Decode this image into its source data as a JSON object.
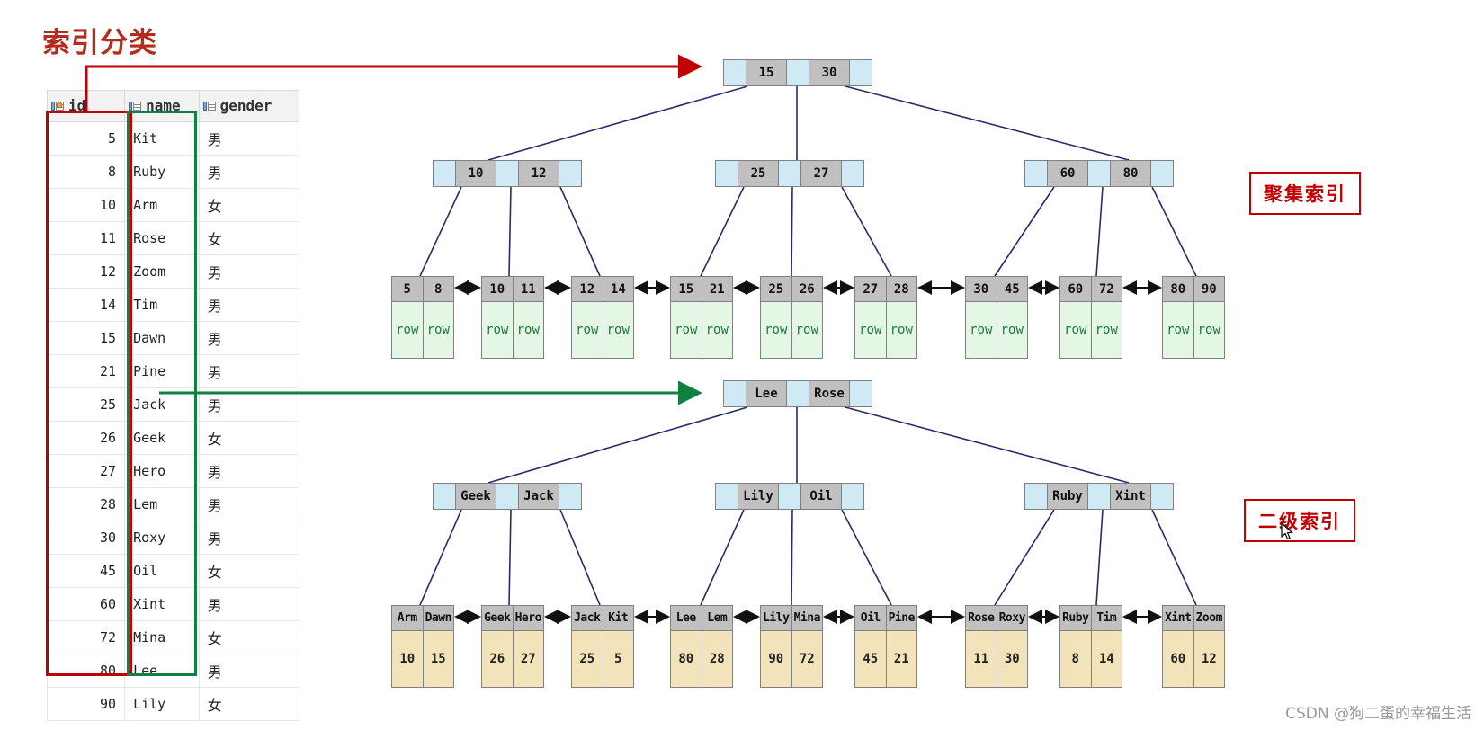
{
  "page": {
    "title": "索引分类",
    "watermark": "CSDN @狗二蛋的幸福生活"
  },
  "table": {
    "columns": [
      {
        "key": "id",
        "label": "id",
        "icon": "primary-key-icon"
      },
      {
        "key": "name",
        "label": "name",
        "icon": "column-icon"
      },
      {
        "key": "gender",
        "label": "gender",
        "icon": "column-icon"
      }
    ],
    "rows": [
      {
        "id": "5",
        "name": "Kit",
        "gender": "男"
      },
      {
        "id": "8",
        "name": "Ruby",
        "gender": "男"
      },
      {
        "id": "10",
        "name": "Arm",
        "gender": "女"
      },
      {
        "id": "11",
        "name": "Rose",
        "gender": "女"
      },
      {
        "id": "12",
        "name": "Zoom",
        "gender": "男"
      },
      {
        "id": "14",
        "name": "Tim",
        "gender": "男"
      },
      {
        "id": "15",
        "name": "Dawn",
        "gender": "男"
      },
      {
        "id": "21",
        "name": "Pine",
        "gender": "男"
      },
      {
        "id": "25",
        "name": "Jack",
        "gender": "男"
      },
      {
        "id": "26",
        "name": "Geek",
        "gender": "女"
      },
      {
        "id": "27",
        "name": "Hero",
        "gender": "男"
      },
      {
        "id": "28",
        "name": "Lem",
        "gender": "男"
      },
      {
        "id": "30",
        "name": "Roxy",
        "gender": "男"
      },
      {
        "id": "45",
        "name": "Oil",
        "gender": "女"
      },
      {
        "id": "60",
        "name": "Xint",
        "gender": "男"
      },
      {
        "id": "72",
        "name": "Mina",
        "gender": "女"
      },
      {
        "id": "80",
        "name": "Lee",
        "gender": "男"
      },
      {
        "id": "90",
        "name": "Lily",
        "gender": "女"
      }
    ],
    "highlight": {
      "id_column_color": "#c00000",
      "name_column_color": "#0f8040"
    }
  },
  "labels": {
    "clustered": "聚集索引",
    "secondary": "二级索引",
    "clustered_color": "#c00000",
    "secondary_color": "#c00000"
  },
  "clustered_index": {
    "root": {
      "keys": [
        "15",
        "30"
      ]
    },
    "internal": [
      {
        "keys": [
          "10",
          "12"
        ]
      },
      {
        "keys": [
          "25",
          "27"
        ]
      },
      {
        "keys": [
          "60",
          "80"
        ]
      }
    ],
    "leaves": [
      {
        "keys": [
          "5",
          "8"
        ],
        "values": [
          "row",
          "row"
        ]
      },
      {
        "keys": [
          "10",
          "11"
        ],
        "values": [
          "row",
          "row"
        ]
      },
      {
        "keys": [
          "12",
          "14"
        ],
        "values": [
          "row",
          "row"
        ]
      },
      {
        "keys": [
          "15",
          "21"
        ],
        "values": [
          "row",
          "row"
        ]
      },
      {
        "keys": [
          "25",
          "26"
        ],
        "values": [
          "row",
          "row"
        ]
      },
      {
        "keys": [
          "27",
          "28"
        ],
        "values": [
          "row",
          "row"
        ]
      },
      {
        "keys": [
          "30",
          "45"
        ],
        "values": [
          "row",
          "row"
        ]
      },
      {
        "keys": [
          "60",
          "72"
        ],
        "values": [
          "row",
          "row"
        ]
      },
      {
        "keys": [
          "80",
          "90"
        ],
        "values": [
          "row",
          "row"
        ]
      }
    ]
  },
  "secondary_index": {
    "root": {
      "keys": [
        "Lee",
        "Rose"
      ]
    },
    "internal": [
      {
        "keys": [
          "Geek",
          "Jack"
        ]
      },
      {
        "keys": [
          "Lily",
          "Oil"
        ]
      },
      {
        "keys": [
          "Ruby",
          "Xint"
        ]
      }
    ],
    "leaves": [
      {
        "keys": [
          "Arm",
          "Dawn"
        ],
        "values": [
          "10",
          "15"
        ]
      },
      {
        "keys": [
          "Geek",
          "Hero"
        ],
        "values": [
          "26",
          "27"
        ]
      },
      {
        "keys": [
          "Jack",
          "Kit"
        ],
        "values": [
          "25",
          "5"
        ]
      },
      {
        "keys": [
          "Lee",
          "Lem"
        ],
        "values": [
          "80",
          "28"
        ]
      },
      {
        "keys": [
          "Lily",
          "Mina"
        ],
        "values": [
          "90",
          "72"
        ]
      },
      {
        "keys": [
          "Oil",
          "Pine"
        ],
        "values": [
          "45",
          "21"
        ]
      },
      {
        "keys": [
          "Rose",
          "Roxy"
        ],
        "values": [
          "11",
          "30"
        ]
      },
      {
        "keys": [
          "Ruby",
          "Tim"
        ],
        "values": [
          "8",
          "14"
        ]
      },
      {
        "keys": [
          "Xint",
          "Zoom"
        ],
        "values": [
          "60",
          "12"
        ]
      }
    ]
  },
  "colors": {
    "pointer_cell": "#cfeaf5",
    "key_cell": "#c0c0c0",
    "clustered_row_cell": "#e4f7e4",
    "secondary_row_cell": "#f2e3ba",
    "edge": "#2a2a6a"
  }
}
